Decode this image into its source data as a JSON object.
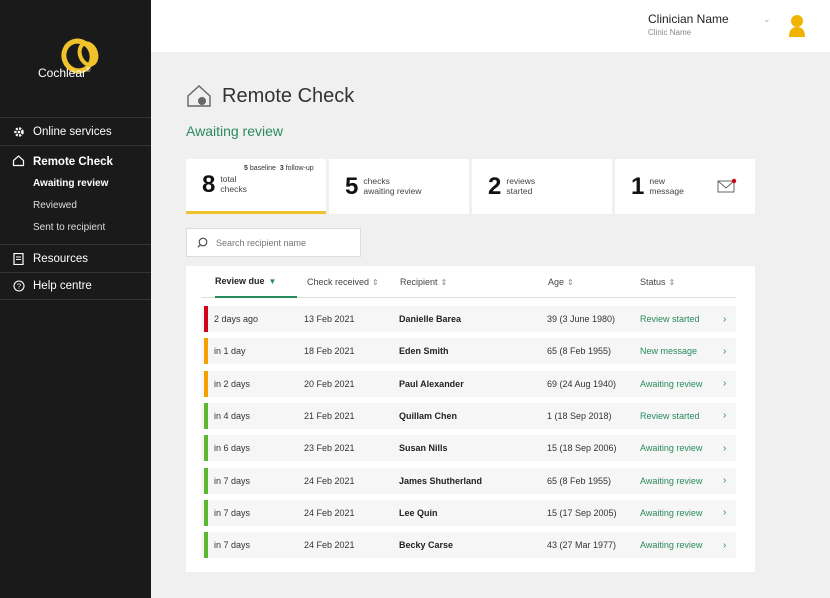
{
  "brand": {
    "name": "Cochlear",
    "mark": "®"
  },
  "user": {
    "name": "Clinician Name",
    "clinic": "Clinic Name"
  },
  "sidebar": {
    "online_services": "Online services",
    "remote_check": "Remote Check",
    "sub_items": [
      "Awaiting review",
      "Reviewed",
      "Sent to recipient"
    ],
    "resources": "Resources",
    "help_centre": "Help centre"
  },
  "page": {
    "title": "Remote Check",
    "section": "Awaiting review"
  },
  "cards": [
    {
      "number": "8",
      "label_line1": "total",
      "label_line2": "checks",
      "note_baseline": "5",
      "note_baseline_label": "baseline",
      "note_followup": "3",
      "note_followup_label": "follow-up"
    },
    {
      "number": "5",
      "label_line1": "checks",
      "label_line2": "awaiting review"
    },
    {
      "number": "2",
      "label_line1": "reviews",
      "label_line2": "started"
    },
    {
      "number": "1",
      "label_line1": "new",
      "label_line2": "message"
    }
  ],
  "search": {
    "placeholder": "Search recipient name"
  },
  "table": {
    "headers": [
      "Review due",
      "Check received",
      "Recipient",
      "Age",
      "Status"
    ],
    "rows": [
      {
        "due": "2 days ago",
        "received": "13 Feb 2021",
        "recipient": "Danielle Barea",
        "age": "39 (3 June 1980)",
        "status": "Review started",
        "color": "#d0021b"
      },
      {
        "due": "in 1 day",
        "received": "18 Feb 2021",
        "recipient": "Eden Smith",
        "age": "65 (8 Feb 1955)",
        "status": "New message",
        "color": "#f5a000"
      },
      {
        "due": "in 2 days",
        "received": "20 Feb 2021",
        "recipient": "Paul Alexander",
        "age": "69 (24 Aug 1940)",
        "status": "Awaiting review",
        "color": "#f5a000"
      },
      {
        "due": "in 4 days",
        "received": "21 Feb 2021",
        "recipient": "Quillam Chen",
        "age": "1 (18 Sep 2018)",
        "status": "Review started",
        "color": "#5cb82e"
      },
      {
        "due": "in 6 days",
        "received": "23 Feb 2021",
        "recipient": "Susan Nills",
        "age": "15 (18 Sep 2006)",
        "status": "Awaiting review",
        "color": "#5cb82e"
      },
      {
        "due": "in 7 days",
        "received": "24 Feb 2021",
        "recipient": "James Shutherland",
        "age": "65 (8 Feb 1955)",
        "status": "Awaiting review",
        "color": "#5cb82e"
      },
      {
        "due": "in 7 days",
        "received": "24 Feb 2021",
        "recipient": "Lee Quin",
        "age": "15 (17 Sep 2005)",
        "status": "Awaiting review",
        "color": "#5cb82e"
      },
      {
        "due": "in 7 days",
        "received": "24 Feb 2021",
        "recipient": "Becky Carse",
        "age": "43 (27 Mar 1977)",
        "status": "Awaiting review",
        "color": "#5cb82e"
      }
    ]
  },
  "colors": {
    "accent_green": "#2a8a5e",
    "accent_yellow": "#f0c22b",
    "sidebar_bg": "#1a1a1a"
  }
}
